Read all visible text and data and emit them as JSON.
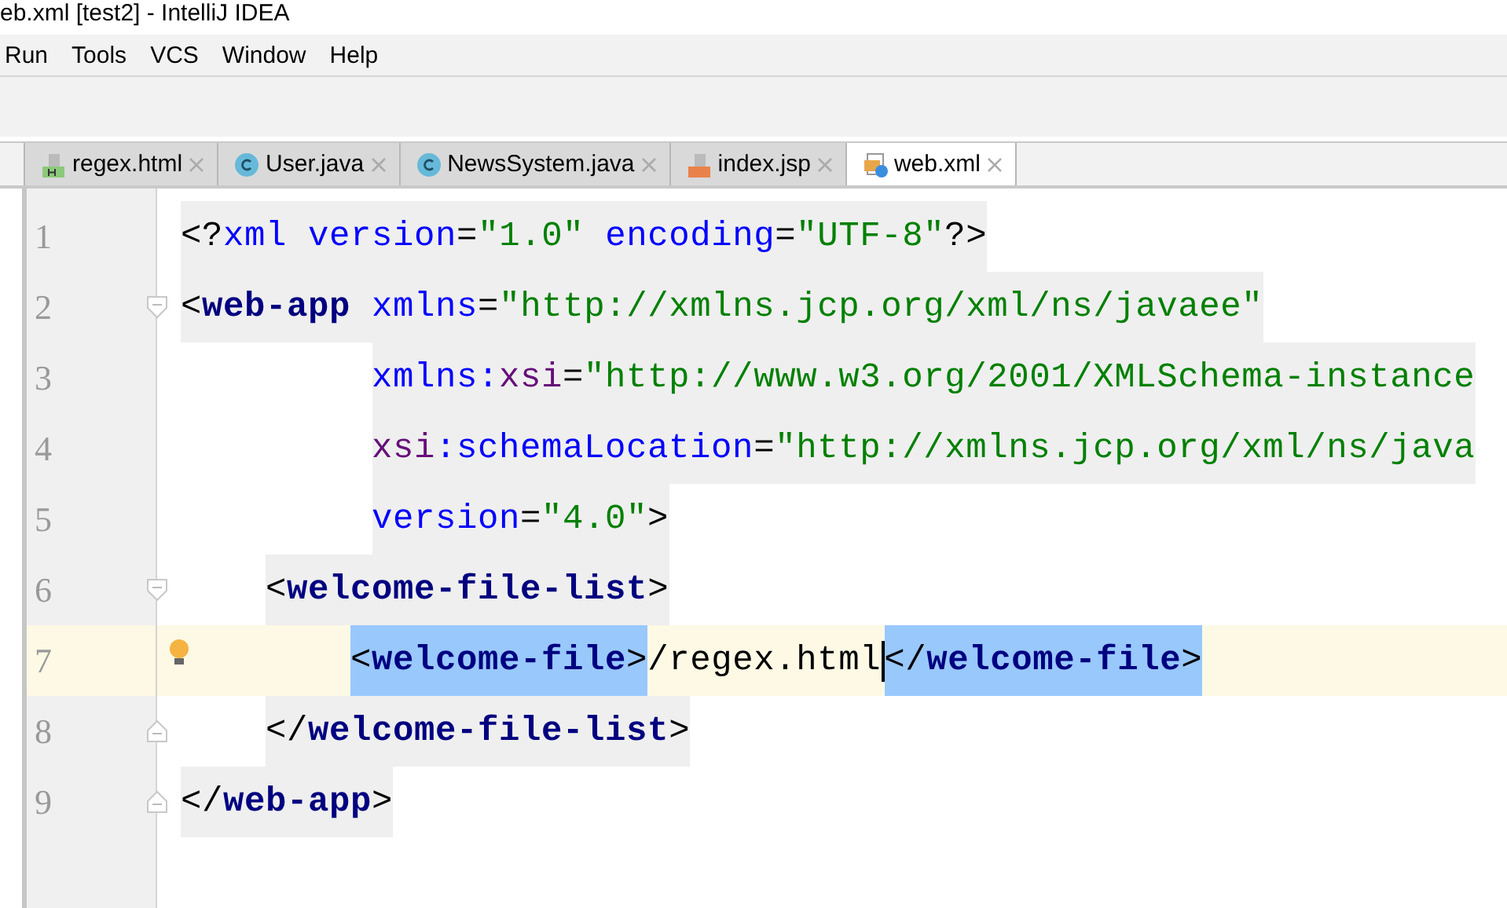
{
  "window": {
    "title": "eb.xml [test2] - IntelliJ IDEA"
  },
  "menu": [
    {
      "label": "Run"
    },
    {
      "label": "Tools"
    },
    {
      "label": "VCS"
    },
    {
      "label": "Window"
    },
    {
      "label": "Help"
    }
  ],
  "tabs": [
    {
      "label": "regex.html",
      "kind": "html",
      "selected": false
    },
    {
      "label": "User.java",
      "kind": "class",
      "selected": false
    },
    {
      "label": "NewsSystem.java",
      "kind": "class",
      "selected": false
    },
    {
      "label": "index.jsp",
      "kind": "jsp",
      "selected": false
    },
    {
      "label": "web.xml",
      "kind": "xml",
      "selected": true
    }
  ],
  "editor": {
    "lines": [
      {
        "number": "1",
        "kind": "element",
        "current": false,
        "fold_open": false,
        "fold_close": false,
        "hint": false,
        "tokens": [
          {
            "kind": "punct",
            "text": "<?"
          },
          {
            "kind": "attr",
            "text": "xml version"
          },
          {
            "kind": "punct",
            "text": "="
          },
          {
            "kind": "value",
            "text": "\"1.0\""
          },
          {
            "kind": "attr",
            "text": " encoding"
          },
          {
            "kind": "punct",
            "text": "="
          },
          {
            "kind": "value",
            "text": "\"UTF-8\""
          },
          {
            "kind": "punct",
            "text": "?>"
          }
        ]
      },
      {
        "number": "2",
        "kind": "element",
        "current": false,
        "fold_open": true,
        "fold_close": false,
        "hint": false,
        "tokens": [
          {
            "kind": "punct",
            "text": "<"
          },
          {
            "kind": "tag",
            "text": "web-app"
          },
          {
            "kind": "attr",
            "text": " xmlns"
          },
          {
            "kind": "punct",
            "text": "="
          },
          {
            "kind": "value",
            "text": "\"http://xmlns.jcp.org/xml/ns/javaee\""
          }
        ],
        "children": [
          {
            "number": "3",
            "kind": "attribute",
            "current": false,
            "fold_open": false,
            "fold_close": false,
            "hint": false,
            "tokens": [
              {
                "kind": "attr",
                "text": "xmlns:"
              },
              {
                "kind": "ns",
                "text": "xsi"
              },
              {
                "kind": "punct",
                "text": "="
              },
              {
                "kind": "value",
                "text": "\"http://www.w3.org/2001/XMLSchema-instance"
              }
            ]
          },
          {
            "number": "4",
            "kind": "attribute",
            "current": false,
            "fold_open": false,
            "fold_close": false,
            "hint": false,
            "tokens": [
              {
                "kind": "ns",
                "text": "xsi"
              },
              {
                "kind": "attr",
                "text": ":schemaLocation"
              },
              {
                "kind": "punct",
                "text": "="
              },
              {
                "kind": "value",
                "text": "\"http://xmlns.jcp.org/xml/ns/java"
              }
            ]
          },
          {
            "number": "5",
            "kind": "attribute",
            "current": false,
            "fold_open": false,
            "fold_close": false,
            "hint": false,
            "tokens": [
              {
                "kind": "attr",
                "text": "version"
              },
              {
                "kind": "punct",
                "text": "="
              },
              {
                "kind": "value",
                "text": "\"4.0\""
              },
              {
                "kind": "punct",
                "text": ">"
              }
            ]
          },
          {
            "number": "6",
            "kind": "element",
            "current": false,
            "fold_open": true,
            "fold_close": false,
            "hint": false,
            "tokens": [
              {
                "kind": "punct",
                "text": "<"
              },
              {
                "kind": "tag",
                "text": "welcome-file-list"
              },
              {
                "kind": "punct",
                "text": ">"
              }
            ],
            "children": [
              {
                "number": "7",
                "kind": "element",
                "current": true,
                "fold_open": false,
                "fold_close": false,
                "hint": true,
                "tokens": [
                  {
                    "kind": "punct",
                    "text": "<",
                    "selected": true
                  },
                  {
                    "kind": "tag",
                    "text": "welcome-file",
                    "selected": true
                  },
                  {
                    "kind": "punct",
                    "text": ">",
                    "selected": true
                  },
                  {
                    "kind": "text",
                    "text": "/regex.html",
                    "caret": true
                  },
                  {
                    "kind": "punct",
                    "text": "</",
                    "selected": true
                  },
                  {
                    "kind": "tag",
                    "text": "welcome-file",
                    "selected": true
                  },
                  {
                    "kind": "punct",
                    "text": ">",
                    "selected": true
                  }
                ]
              }
            ]
          },
          {
            "number": "8",
            "kind": "element",
            "current": false,
            "fold_open": false,
            "fold_close": true,
            "hint": false,
            "tokens": [
              {
                "kind": "punct",
                "text": "</"
              },
              {
                "kind": "tag",
                "text": "welcome-file-list"
              },
              {
                "kind": "punct",
                "text": ">"
              }
            ]
          }
        ]
      },
      {
        "number": "9",
        "kind": "element",
        "current": false,
        "fold_open": false,
        "fold_close": true,
        "hint": false,
        "tokens": [
          {
            "kind": "punct",
            "text": "</"
          },
          {
            "kind": "tag",
            "text": "web-app"
          },
          {
            "kind": "punct",
            "text": ">"
          }
        ]
      }
    ]
  }
}
